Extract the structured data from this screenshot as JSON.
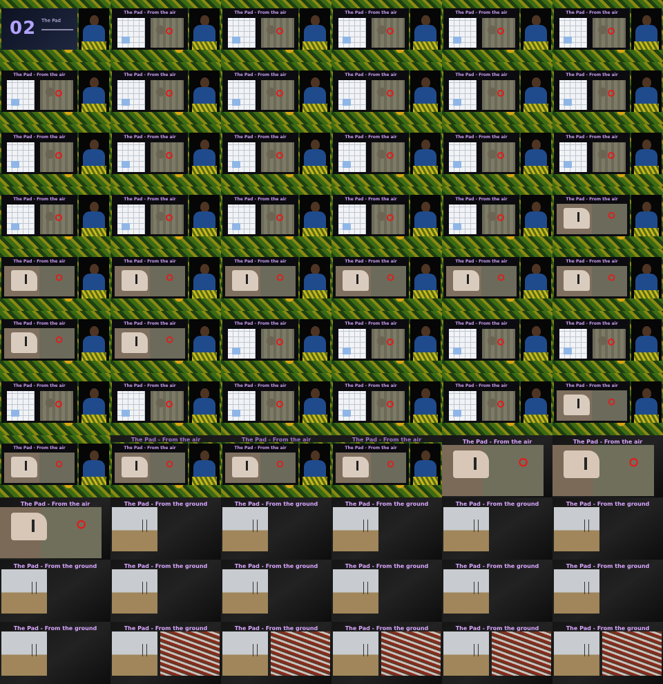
{
  "frames": [
    {
      "type": "cover",
      "num": "02",
      "title": "The Pad"
    },
    {
      "type": "split",
      "content": "map",
      "title": "The Pad - From the air"
    },
    {
      "type": "split",
      "content": "map",
      "title": "The Pad - From the air"
    },
    {
      "type": "split",
      "content": "map",
      "title": "The Pad - From the air"
    },
    {
      "type": "split",
      "content": "map",
      "title": "The Pad - From the air"
    },
    {
      "type": "split",
      "content": "map",
      "title": "The Pad - From the air"
    },
    {
      "type": "split",
      "content": "map",
      "title": "The Pad - From the air"
    },
    {
      "type": "split",
      "content": "map",
      "title": "The Pad - From the air"
    },
    {
      "type": "split",
      "content": "map",
      "title": "The Pad - From the air"
    },
    {
      "type": "split",
      "content": "map",
      "title": "The Pad - From the air"
    },
    {
      "type": "split",
      "content": "map",
      "title": "The Pad - From the air"
    },
    {
      "type": "split",
      "content": "map",
      "title": "The Pad - From the air"
    },
    {
      "type": "split",
      "content": "map",
      "title": "The Pad - From the air"
    },
    {
      "type": "split",
      "content": "map",
      "title": "The Pad - From the air"
    },
    {
      "type": "split",
      "content": "map",
      "title": "The Pad - From the air"
    },
    {
      "type": "split",
      "content": "map",
      "title": "The Pad - From the air"
    },
    {
      "type": "split",
      "content": "map",
      "title": "The Pad - From the air"
    },
    {
      "type": "split",
      "content": "map",
      "title": "The Pad - From the air"
    },
    {
      "type": "split",
      "content": "map",
      "title": "The Pad - From the air"
    },
    {
      "type": "split",
      "content": "map",
      "title": "The Pad - From the air"
    },
    {
      "type": "split",
      "content": "map",
      "title": "The Pad - From the air"
    },
    {
      "type": "split",
      "content": "map",
      "title": "The Pad - From the air"
    },
    {
      "type": "split",
      "content": "map",
      "title": "The Pad - From the air"
    },
    {
      "type": "split",
      "content": "pad",
      "title": "The Pad - From the air"
    },
    {
      "type": "split",
      "content": "pad",
      "title": "The Pad - From the air"
    },
    {
      "type": "split",
      "content": "pad",
      "title": "The Pad - From the air"
    },
    {
      "type": "split",
      "content": "pad",
      "title": "The Pad - From the air"
    },
    {
      "type": "split",
      "content": "pad",
      "title": "The Pad - From the air"
    },
    {
      "type": "split",
      "content": "pad",
      "title": "The Pad - From the air"
    },
    {
      "type": "split",
      "content": "pad",
      "title": "The Pad - From the air"
    },
    {
      "type": "split",
      "content": "pad",
      "title": "The Pad - From the air"
    },
    {
      "type": "split",
      "content": "pad",
      "title": "The Pad - From the air"
    },
    {
      "type": "split",
      "content": "map",
      "title": "The Pad - From the air"
    },
    {
      "type": "split",
      "content": "map",
      "title": "The Pad - From the air"
    },
    {
      "type": "split",
      "content": "map",
      "title": "The Pad - From the air"
    },
    {
      "type": "split",
      "content": "map",
      "title": "The Pad - From the air"
    },
    {
      "type": "split",
      "content": "map",
      "title": "The Pad - From the air"
    },
    {
      "type": "split",
      "content": "map",
      "title": "The Pad - From the air"
    },
    {
      "type": "split",
      "content": "map",
      "title": "The Pad - From the air"
    },
    {
      "type": "split",
      "content": "map",
      "title": "The Pad - From the air"
    },
    {
      "type": "split",
      "content": "map",
      "title": "The Pad - From the air"
    },
    {
      "type": "split",
      "content": "pad",
      "title": "The Pad - From the air"
    },
    {
      "type": "split",
      "content": "pad",
      "title": "The Pad - From the air"
    },
    {
      "type": "transition",
      "content": "pad",
      "title": "The Pad - From the air",
      "overlay": "The Pad - From the air"
    },
    {
      "type": "transition",
      "content": "pad",
      "title": "The Pad - From the air",
      "overlay": "The Pad - From the air"
    },
    {
      "type": "transition",
      "content": "pad",
      "title": "The Pad - From the air",
      "overlay": "The Pad - From the air"
    },
    {
      "type": "full",
      "content": "pad",
      "title": "The Pad - From the air"
    },
    {
      "type": "full",
      "content": "pad",
      "title": "The Pad - From the air"
    },
    {
      "type": "full",
      "content": "pad",
      "title": "The Pad - From the air"
    },
    {
      "type": "full",
      "content": "ground",
      "title": "The Pad - From the ground"
    },
    {
      "type": "full",
      "content": "ground",
      "title": "The Pad - From the ground"
    },
    {
      "type": "full",
      "content": "ground",
      "title": "The Pad - From the ground"
    },
    {
      "type": "full",
      "content": "ground",
      "title": "The Pad - From the ground"
    },
    {
      "type": "full",
      "content": "ground",
      "title": "The Pad - From the ground"
    },
    {
      "type": "full",
      "content": "ground",
      "title": "The Pad - From the ground"
    },
    {
      "type": "full",
      "content": "ground",
      "title": "The Pad - From the ground"
    },
    {
      "type": "full",
      "content": "ground",
      "title": "The Pad - From the ground"
    },
    {
      "type": "full",
      "content": "ground",
      "title": "The Pad - From the ground"
    },
    {
      "type": "full",
      "content": "ground",
      "title": "The Pad - From the ground"
    },
    {
      "type": "full",
      "content": "ground",
      "title": "The Pad - From the ground"
    },
    {
      "type": "full",
      "content": "ground",
      "title": "The Pad - From the ground"
    },
    {
      "type": "full",
      "content": "ground-rig",
      "title": "The Pad - From the ground"
    },
    {
      "type": "full",
      "content": "ground-rig",
      "title": "The Pad - From the ground"
    },
    {
      "type": "full",
      "content": "ground-rig",
      "title": "The Pad - From the ground"
    },
    {
      "type": "full",
      "content": "ground-rig",
      "title": "The Pad - From the ground"
    },
    {
      "type": "full",
      "content": "ground-rig",
      "title": "The Pad - From the ground"
    }
  ]
}
